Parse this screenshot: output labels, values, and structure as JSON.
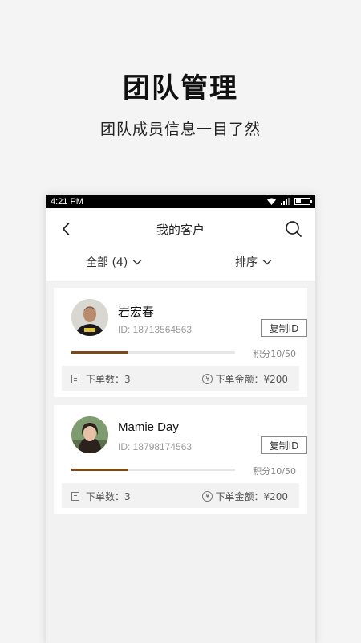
{
  "promo": {
    "title": "团队管理",
    "subtitle": "团队成员信息一目了然"
  },
  "status_bar": {
    "time": "4:21 PM",
    "battery_level": 0.35
  },
  "nav": {
    "title": "我的客户",
    "back_icon": "chevron-left-icon",
    "search_icon": "search-icon"
  },
  "filters": {
    "all_label": "全部 (4)",
    "sort_label": "排序"
  },
  "colors": {
    "progress_fill": "#7a4a1a",
    "progress_track": "#e6e6e6",
    "status_bar_bg": "#000000"
  },
  "customers": [
    {
      "name": "岩宏春",
      "id_text": "ID: 18713564563",
      "copy_label": "复制ID",
      "points_text": "积分10/50",
      "progress": 0.35,
      "orders_text": "下单数：3",
      "amount_text": "下单金额：¥200",
      "orders_icon": "document-icon",
      "amount_icon": "yen-circle-icon"
    },
    {
      "name": "Mamie Day",
      "id_text": "ID: 18798174563",
      "copy_label": "复制ID",
      "points_text": "积分10/50",
      "progress": 0.35,
      "orders_text": "下单数：3",
      "amount_text": "下单金额：¥200",
      "orders_icon": "document-icon",
      "amount_icon": "yen-circle-icon"
    }
  ]
}
